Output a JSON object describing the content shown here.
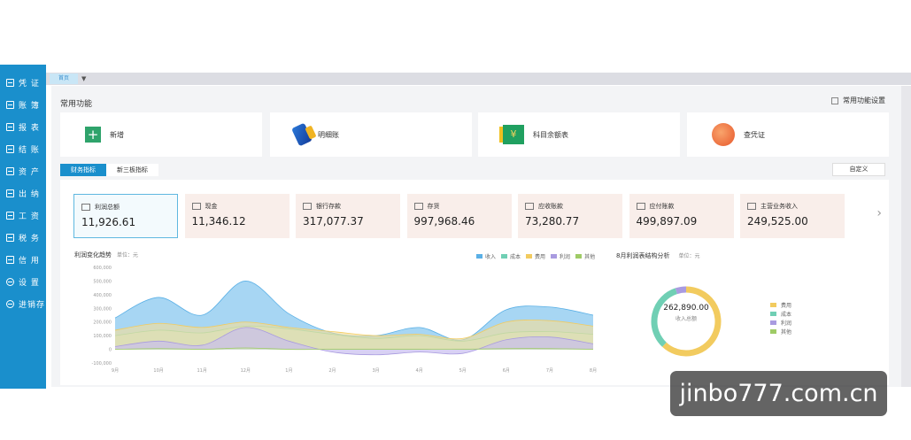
{
  "sidebar": {
    "items": [
      {
        "label": "凭 证",
        "icon": "voucher-icon"
      },
      {
        "label": "账 簿",
        "icon": "ledger-icon"
      },
      {
        "label": "报 表",
        "icon": "report-icon"
      },
      {
        "label": "结 账",
        "icon": "checkout-icon"
      },
      {
        "label": "资 产",
        "icon": "asset-icon"
      },
      {
        "label": "出 纳",
        "icon": "cashier-icon"
      },
      {
        "label": "工 资",
        "icon": "salary-icon"
      },
      {
        "label": "税 务",
        "icon": "tax-icon"
      },
      {
        "label": "信 用",
        "icon": "credit-icon"
      },
      {
        "label": "设 置",
        "icon": "gear-icon"
      },
      {
        "label": "进销存",
        "icon": "inventory-icon"
      }
    ]
  },
  "tabbar": {
    "active_tab": "首页"
  },
  "quick": {
    "title": "常用功能",
    "settings_label": "常用功能设置",
    "cards": [
      {
        "label": "新增",
        "icon": "plus-icon"
      },
      {
        "label": "明细账",
        "icon": "tag-icon"
      },
      {
        "label": "科目余额表",
        "icon": "money-icon"
      },
      {
        "label": "查凭证",
        "icon": "voucher-search-icon"
      }
    ]
  },
  "subtabs": {
    "items": [
      "财务指标",
      "新三板指标"
    ],
    "customize_label": "自定义"
  },
  "kpis": [
    {
      "title": "利润总额",
      "value": "11,926.61"
    },
    {
      "title": "现金",
      "value": "11,346.12"
    },
    {
      "title": "银行存款",
      "value": "317,077.37"
    },
    {
      "title": "存货",
      "value": "997,968.46"
    },
    {
      "title": "应收账款",
      "value": "73,280.77"
    },
    {
      "title": "应付账款",
      "value": "499,897.09"
    },
    {
      "title": "主营业务收入",
      "value": "249,525.00"
    }
  ],
  "trend": {
    "title": "利润变化趋势",
    "unit": "单位：元"
  },
  "pie": {
    "title": "8月利润表结构分析",
    "unit": "单位：元",
    "center_value": "262,890.00",
    "center_label": "收入总额",
    "legend": [
      "费用",
      "成本",
      "利润",
      "其他"
    ]
  },
  "colors": {
    "accent": "#1a8fcc",
    "income": "#5ab0e6",
    "cost": "#70cfb4",
    "expense": "#f2cb5f",
    "profit": "#a99be0",
    "other": "#9fcb66"
  },
  "chart_data": [
    {
      "type": "area",
      "title": "利润变化趋势",
      "categories": [
        "9月",
        "10月",
        "11月",
        "12月",
        "1月",
        "2月",
        "3月",
        "4月",
        "5月",
        "6月",
        "7月",
        "8月"
      ],
      "yticks": [
        "600,000",
        "500,000",
        "400,000",
        "300,000",
        "200,000",
        "100,000",
        "0",
        "-100,000"
      ],
      "ylim": [
        -100000,
        600000
      ],
      "series": [
        {
          "name": "收入",
          "values": [
            230000,
            380000,
            250000,
            500000,
            260000,
            120000,
            100000,
            160000,
            70000,
            290000,
            310000,
            250000
          ]
        },
        {
          "name": "成本",
          "values": [
            100000,
            140000,
            120000,
            170000,
            150000,
            110000,
            80000,
            100000,
            60000,
            120000,
            130000,
            110000
          ]
        },
        {
          "name": "费用",
          "values": [
            140000,
            190000,
            160000,
            200000,
            160000,
            130000,
            100000,
            110000,
            80000,
            200000,
            210000,
            170000
          ]
        },
        {
          "name": "利润",
          "values": [
            20000,
            60000,
            30000,
            160000,
            60000,
            -20000,
            -40000,
            -20000,
            -30000,
            70000,
            90000,
            40000
          ]
        },
        {
          "name": "其他",
          "values": [
            0,
            5000,
            0,
            10000,
            0,
            0,
            0,
            0,
            0,
            5000,
            5000,
            0
          ]
        }
      ],
      "legend_position": "top-right"
    },
    {
      "type": "pie",
      "title": "8月利润表结构分析",
      "labels": [
        "费用",
        "成本",
        "利润",
        "其他"
      ],
      "values": [
        62,
        33,
        5,
        0
      ],
      "center_value": "262,890.00",
      "center_label": "收入总额"
    }
  ]
}
